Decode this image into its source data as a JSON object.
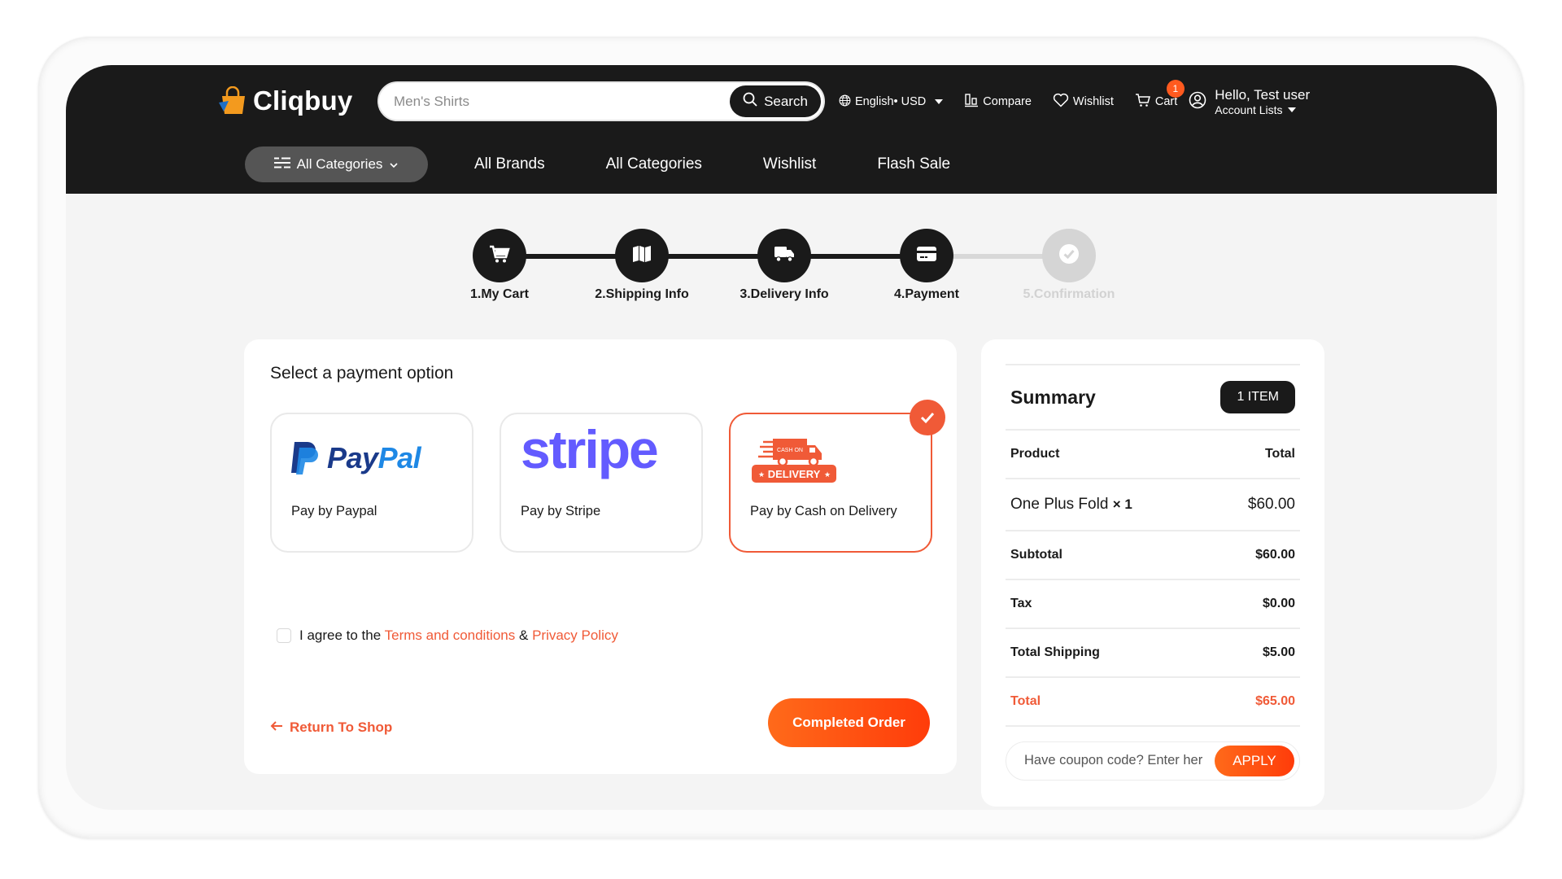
{
  "brand": {
    "name": "Cliqbuy",
    "accent": "#f05a37",
    "dark": "#1a1a1a"
  },
  "header": {
    "search": {
      "placeholder": "Men's Shirts",
      "value": "",
      "button_label": "Search"
    },
    "language": "English• USD",
    "compare": "Compare",
    "wishlist": "Wishlist",
    "cart": {
      "label": "Cart",
      "count": "1"
    },
    "account": {
      "greeting": "Hello, Test user",
      "menu": "Account Lists"
    }
  },
  "nav": {
    "categories_button": "All Categories",
    "links": [
      "All Brands",
      "All Categories",
      "Wishlist",
      "Flash Sale"
    ]
  },
  "stepper": {
    "steps": [
      {
        "label": "1.My Cart",
        "icon": "cart-icon",
        "status": "complete"
      },
      {
        "label": "2.Shipping Info",
        "icon": "map-icon",
        "status": "complete"
      },
      {
        "label": "3.Delivery Info",
        "icon": "truck-icon",
        "status": "complete"
      },
      {
        "label": "4.Payment",
        "icon": "credit-card-icon",
        "status": "current"
      },
      {
        "label": "5.Confirmation",
        "icon": "check-circle-icon",
        "status": "pending"
      }
    ]
  },
  "payment": {
    "title": "Select a payment option",
    "options": [
      {
        "logo_text": "PayPal",
        "logo_prefix": "Pay",
        "logo_suffix": "Pal",
        "label": "Pay by Paypal",
        "selected": false
      },
      {
        "logo_text": "stripe",
        "label": "Pay by Stripe",
        "selected": false
      },
      {
        "logo_text": "DELIVERY",
        "logo_small": "CASH ON",
        "label": "Pay by Cash on Delivery",
        "selected": true
      }
    ],
    "agree": {
      "checked": false,
      "prefix": "I agree to the",
      "terms": "Terms and conditions",
      "amp": "&",
      "privacy": "Privacy Policy"
    },
    "return_link": "Return To Shop",
    "submit": "Completed Order"
  },
  "summary": {
    "title": "Summary",
    "badge": "1 ITEM",
    "columns": [
      "Product",
      "Total"
    ],
    "items": [
      {
        "name": "One Plus Fold",
        "qty": "× 1",
        "price": "$60.00"
      }
    ],
    "subtotal": {
      "label": "Subtotal",
      "value": "$60.00"
    },
    "tax": {
      "label": "Tax",
      "value": "$0.00"
    },
    "shipping": {
      "label": "Total Shipping",
      "value": "$5.00"
    },
    "total": {
      "label": "Total",
      "value": "$65.00"
    },
    "coupon": {
      "placeholder": "Have coupon code? Enter here",
      "value": "",
      "button": "APPLY"
    }
  }
}
